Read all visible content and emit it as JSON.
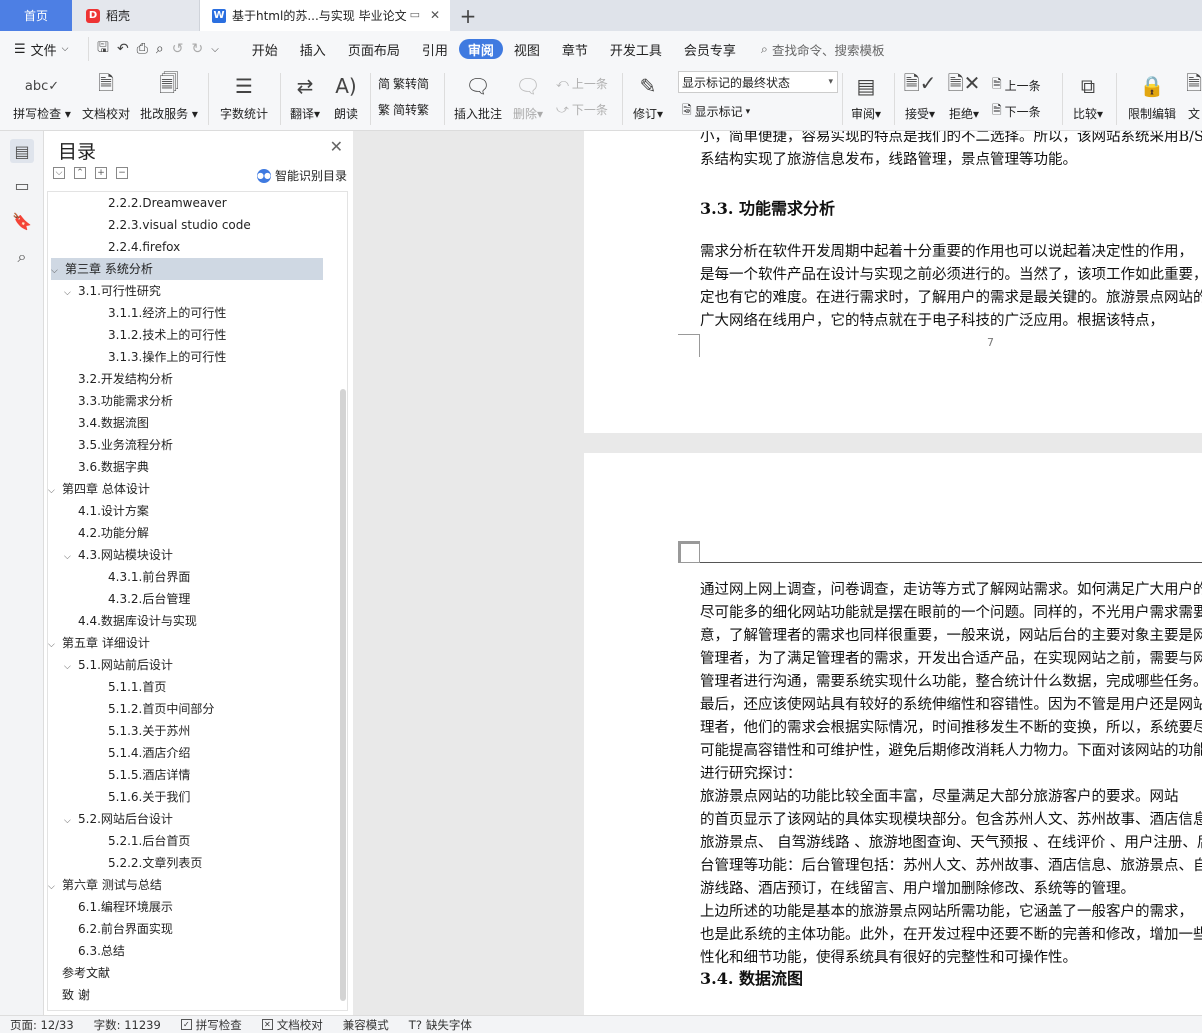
{
  "tabs": {
    "home": "首页",
    "daoke": "稻壳",
    "doc": "基于html的苏...与实现 毕业论文",
    "new": "+"
  },
  "menu": {
    "file": "文件",
    "items": [
      "开始",
      "插入",
      "页面布局",
      "引用",
      "审阅",
      "视图",
      "章节",
      "开发工具",
      "会员专享"
    ],
    "active": "审阅",
    "search": "查找命令、搜索模板"
  },
  "ribbon": {
    "spell": "拼写检查",
    "proof": "文档校对",
    "batch": "批改服务",
    "count": "字数统计",
    "translate": "翻译",
    "read": "朗读",
    "t2s": "繁转简",
    "s2t": "简转繁",
    "insert_comment": "插入批注",
    "delete": "删除",
    "prev": "上一条",
    "next": "下一条",
    "revise": "修订",
    "markup_select": "显示标记的最终状态",
    "show_markup": "显示标记",
    "review": "审阅",
    "accept": "接受",
    "reject": "拒绝",
    "prev2": "上一条",
    "next2": "下一条",
    "compare": "比较",
    "restrict": "限制编辑",
    "doc_more": "文"
  },
  "toc": {
    "title": "目录",
    "smart": "智能识别目录",
    "items": [
      {
        "t": "2.2.2.Dreamweaver",
        "lv": 3
      },
      {
        "t": "2.2.3.visual studio code",
        "lv": 3
      },
      {
        "t": "2.2.4.firefox",
        "lv": 3
      },
      {
        "t": "第三章  系统分析",
        "lv": 1,
        "exp": true,
        "sel": true
      },
      {
        "t": "3.1.可行性研究",
        "lv": 2,
        "exp": true
      },
      {
        "t": "3.1.1.经济上的可行性",
        "lv": 3
      },
      {
        "t": "3.1.2.技术上的可行性",
        "lv": 3
      },
      {
        "t": "3.1.3.操作上的可行性",
        "lv": 3
      },
      {
        "t": "3.2.开发结构分析",
        "lv": 2
      },
      {
        "t": "3.3.功能需求分析",
        "lv": 2
      },
      {
        "t": "3.4.数据流图",
        "lv": 2
      },
      {
        "t": "3.5.业务流程分析",
        "lv": 2
      },
      {
        "t": "3.6.数据字典",
        "lv": 2
      },
      {
        "t": "第四章  总体设计",
        "lv": 1,
        "exp": true
      },
      {
        "t": "4.1.设计方案",
        "lv": 2
      },
      {
        "t": "4.2.功能分解",
        "lv": 2
      },
      {
        "t": "4.3.网站模块设计",
        "lv": 2,
        "exp": true
      },
      {
        "t": "4.3.1.前台界面",
        "lv": 3
      },
      {
        "t": "4.3.2.后台管理",
        "lv": 3
      },
      {
        "t": "4.4.数据库设计与实现",
        "lv": 2
      },
      {
        "t": "第五章  详细设计",
        "lv": 1,
        "exp": true
      },
      {
        "t": "5.1.网站前后设计",
        "lv": 2,
        "exp": true
      },
      {
        "t": "5.1.1.首页",
        "lv": 3
      },
      {
        "t": "5.1.2.首页中间部分",
        "lv": 3
      },
      {
        "t": "5.1.3.关于苏州",
        "lv": 3
      },
      {
        "t": "5.1.4.酒店介绍",
        "lv": 3
      },
      {
        "t": "5.1.5.酒店详情",
        "lv": 3
      },
      {
        "t": "5.1.6.关于我们",
        "lv": 3
      },
      {
        "t": "5.2.网站后台设计",
        "lv": 2,
        "exp": true
      },
      {
        "t": "5.2.1.后台首页",
        "lv": 3
      },
      {
        "t": "5.2.2.文章列表页",
        "lv": 3
      },
      {
        "t": "第六章  测试与总结",
        "lv": 1,
        "exp": true
      },
      {
        "t": "6.1.编程环境展示",
        "lv": 2
      },
      {
        "t": "6.2.前台界面实现",
        "lv": 2
      },
      {
        "t": "6.3.总结",
        "lv": 2
      },
      {
        "t": "参考文献",
        "lv": 1
      },
      {
        "t": "致    谢",
        "lv": 1
      }
    ]
  },
  "doc": {
    "p1_lines": [
      "小，简单便捷，容易实现的特点是我们的不二选择。所以，该网站系统采用B/S",
      "系结构实现了旅游信息发布，线路管理，景点管理等功能。"
    ],
    "h33": "3.3.  功能需求分析",
    "p2_lines": [
      "        需求分析在软件开发周期中起着十分重要的作用也可以说起着决定性的作用，",
      "是每一个软件产品在设计与实现之前必须进行的。当然了，该项工作如此重要，",
      "定也有它的难度。在进行需求时，了解用户的需求是最关键的。旅游景点网站的",
      "广大网络在线用户，它的特点就在于电子科技的广泛应用。根据该特点，"
    ],
    "page_num": "7",
    "p3_lines": [
      "通过网上网上调查，问卷调查，走访等方式了解网站需求。如何满足广大用户的",
      "尽可能多的细化网站功能就是摆在眼前的一个问题。同样的，不光用户需求需要",
      "意，了解管理者的需求也同样很重要，一般来说，网站后台的主要对象主要是网",
      "管理者，为了满足管理者的需求，开发出合适产品，在实现网站之前，需要与网",
      "管理者进行沟通，需要系统实现什么功能，整合统计什么数据，完成哪些任务。",
      "最后，还应该使网站具有较好的系统伸缩性和容错性。因为不管是用户还是网站",
      "理者，他们的需求会根据实际情况，时间推移发生不断的变换，所以，系统要尽",
      "可能提高容错性和可维护性，避免后期修改消耗人力物力。下面对该网站的功能",
      "进行研究探讨：",
      "        旅游景点网站的功能比较全面丰富，尽量满足大部分旅游客户的要求。网站",
      "的首页显示了该网站的具体实现模块部分。包含苏州人文、苏州故事、酒店信息、",
      "旅游景点、 自驾游线路 、旅游地图查询、天气预报 、在线评价 、用户注册、后",
      "台管理等功能：后台管理包括：苏州人文、苏州故事、酒店信息、旅游景点、自驾",
      "游线路、酒店预订，在线留言、用户增加删除修改、系统等的管理。",
      "        上边所述的功能是基本的旅游景点网站所需功能，它涵盖了一般客户的需求，",
      "也是此系统的主体功能。此外，在开发过程中还要不断的完善和修改，增加一些人",
      "性化和细节功能，使得系统具有很好的完整性和可操作性。"
    ],
    "h34": "3.4.  数据流图"
  },
  "status": {
    "page": "页面: 12/33",
    "words": "字数: 11239",
    "spell": "拼写检查",
    "proof": "文档校对",
    "compat": "兼容模式",
    "font": "缺失字体"
  },
  "colors": {
    "accent": "#3f7ae0",
    "home_tab": "#4d7fe4",
    "toc_selected": "#cfd8e3"
  }
}
